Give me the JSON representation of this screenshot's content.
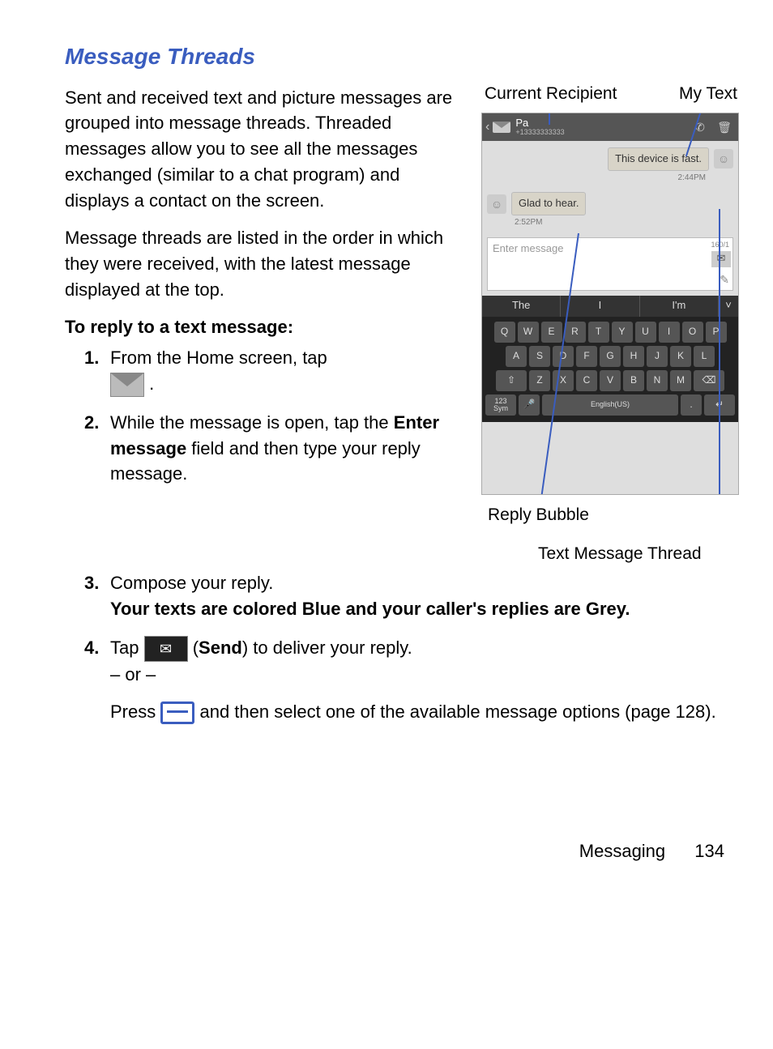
{
  "heading": "Message Threads",
  "para1": "Sent and received text and picture messages are grouped into message threads. Threaded messages allow you to see all the messages exchanged (similar to a chat program) and displays a contact on the screen.",
  "para2": "Message threads are listed in the order in which they were received, with the latest message displayed at the top.",
  "subheading": "To reply to a text message:",
  "steps": {
    "s1": "From the Home screen, tap",
    "s1_after": ".",
    "s2_a": "While the message is open, tap the ",
    "s2_b": "Enter message",
    "s2_c": " field and then type your reply message.",
    "s3_a": "Compose your reply.",
    "s3_b": "Your texts are colored Blue and your caller's replies are Grey.",
    "s4_a": "Tap ",
    "s4_b": " (",
    "s4_c": "Send",
    "s4_d": ") to deliver your reply.",
    "s4_or": "– or –",
    "s4_e": "Press ",
    "s4_f": " and then select one of the available message options (page 128)."
  },
  "figure": {
    "label_recipient": "Current Recipient",
    "label_mytext": "My Text",
    "label_reply": "Reply Bubble",
    "label_thread": "Text Message Thread",
    "contact_name": "Pa",
    "contact_number": "+13333333333",
    "msg1": "This device is fast.",
    "time1": "2:44PM",
    "msg2": "Glad to hear.",
    "time2": "2:52PM",
    "placeholder": "Enter message",
    "counter": "160/1",
    "suggest1": "The",
    "suggest2": "I",
    "suggest3": "I'm",
    "kbd_lang": "English(US)",
    "sym": "123\nSym"
  },
  "footer": {
    "section": "Messaging",
    "page": "134"
  }
}
